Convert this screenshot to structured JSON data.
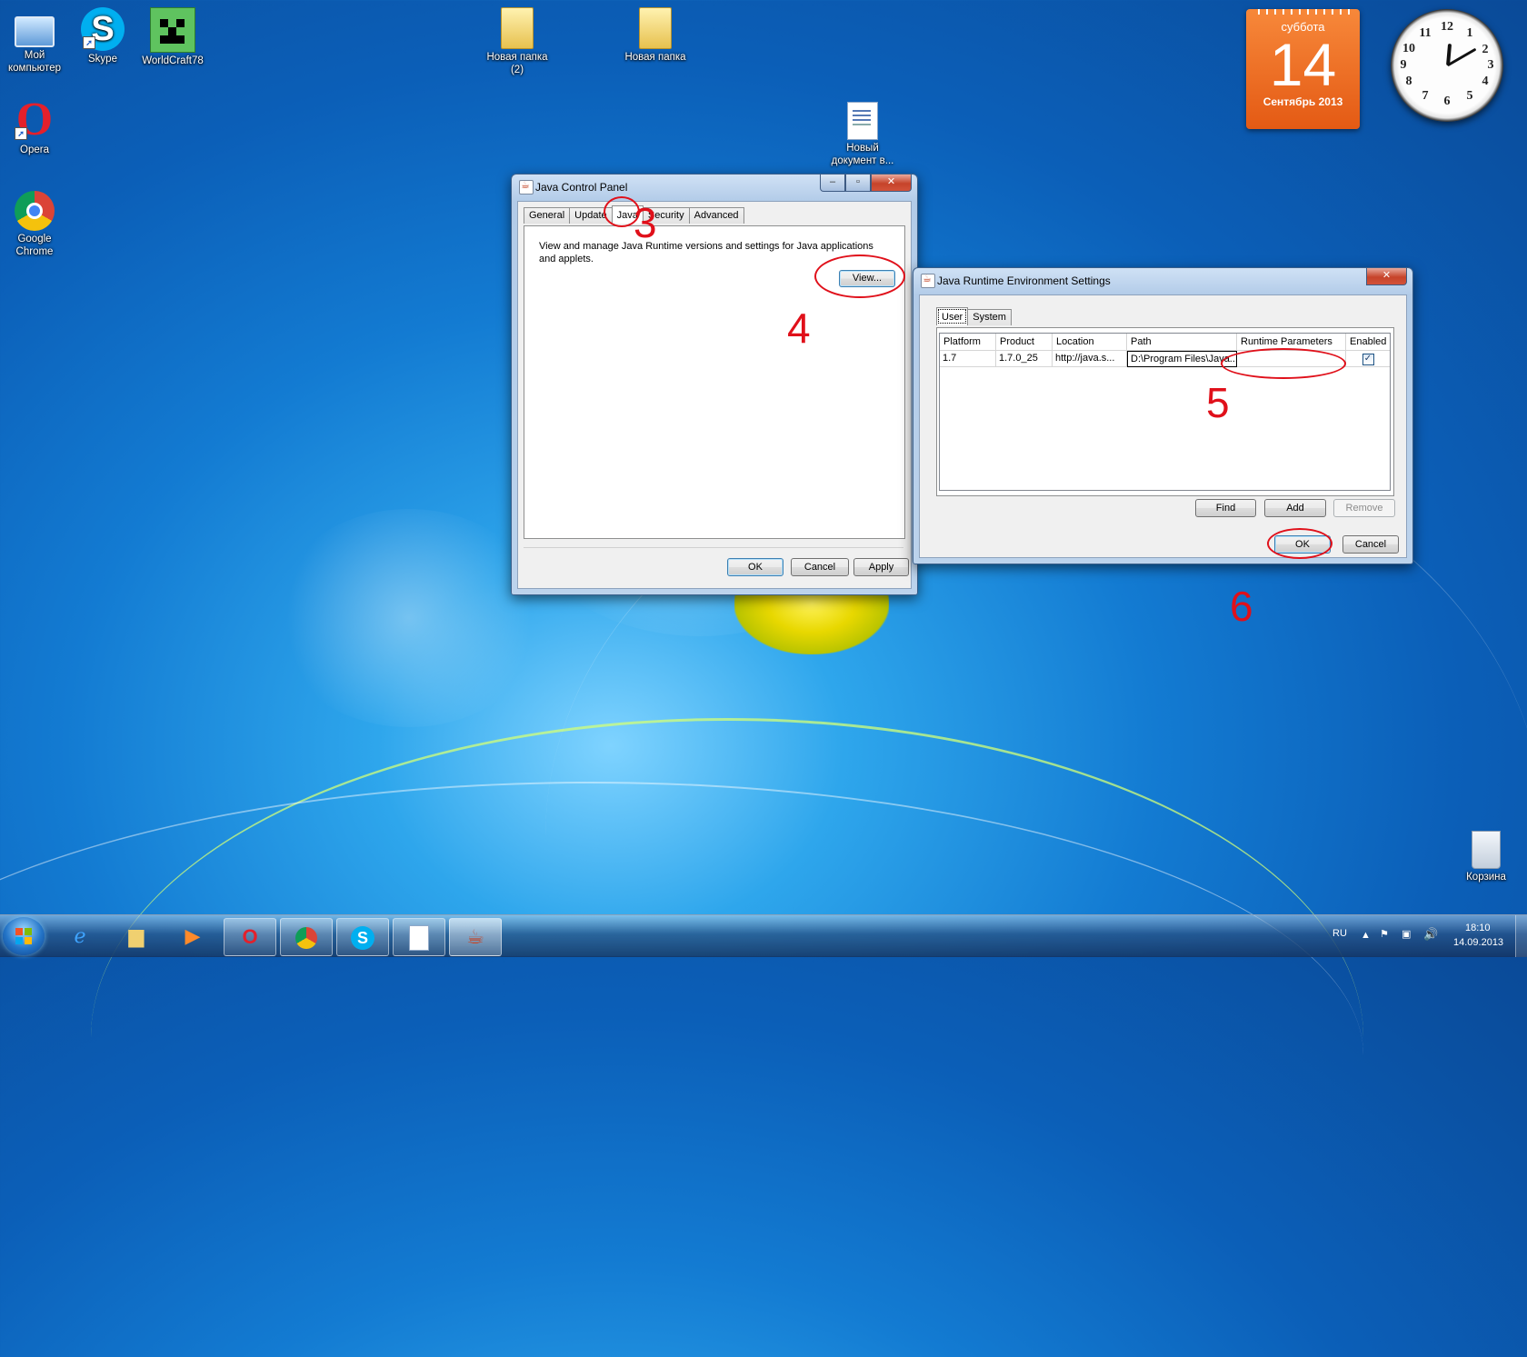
{
  "desktop": {
    "icons": [
      {
        "label": "Мой компьютер"
      },
      {
        "label": "Skype"
      },
      {
        "label": "WorldCraft78"
      },
      {
        "label": "Новая папка (2)"
      },
      {
        "label": "Новая папка"
      },
      {
        "label": "Opera"
      },
      {
        "label": "Новый документ в..."
      },
      {
        "label": "Google Chrome"
      },
      {
        "label": "Корзина"
      }
    ]
  },
  "calendar": {
    "day_of_week": "суббота",
    "day": "14",
    "month_year": "Сентябрь 2013"
  },
  "clock": {
    "numbers": [
      "12",
      "1",
      "2",
      "3",
      "4",
      "5",
      "6",
      "7",
      "8",
      "9",
      "10",
      "11"
    ]
  },
  "java_control_panel": {
    "title": "Java Control Panel",
    "tabs": [
      {
        "label": "General"
      },
      {
        "label": "Update"
      },
      {
        "label": "Java"
      },
      {
        "label": "Security"
      },
      {
        "label": "Advanced"
      }
    ],
    "active_tab": "Java",
    "description": "View and manage Java Runtime versions and settings for Java applications and applets.",
    "view_button": "View...",
    "ok": "OK",
    "cancel": "Cancel",
    "apply": "Apply"
  },
  "jre_settings": {
    "title": "Java Runtime Environment Settings",
    "tabs": [
      {
        "label": "User"
      },
      {
        "label": "System"
      }
    ],
    "active_tab": "User",
    "columns": [
      "Platform",
      "Product",
      "Location",
      "Path",
      "Runtime Parameters",
      "Enabled"
    ],
    "rows": [
      {
        "platform": "1.7",
        "product": "1.7.0_25",
        "location": "http://java.s...",
        "path": "D:\\Program Files\\Java...",
        "runtime_parameters": "",
        "enabled": true
      }
    ],
    "find": "Find",
    "add": "Add",
    "remove": "Remove",
    "ok": "OK",
    "cancel": "Cancel"
  },
  "annotations": {
    "step3": "3",
    "step4": "4",
    "step5": "5",
    "step6": "6",
    "color": "#e0101a"
  },
  "taskbar": {
    "apps": [
      "internet-explorer",
      "explorer",
      "media-player",
      "opera",
      "chrome",
      "skype",
      "document",
      "java"
    ],
    "language": "RU",
    "time": "18:10",
    "date": "14.09.2013"
  }
}
